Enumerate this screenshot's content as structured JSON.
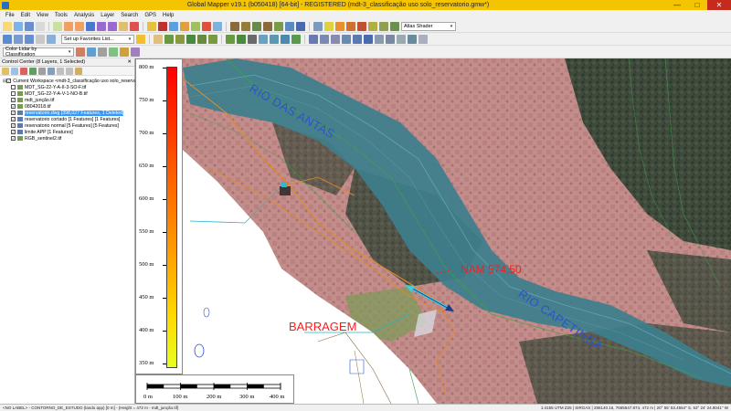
{
  "window": {
    "title": "Global Mapper v19.1 (b050418) [64-bit] - REGISTERED (mdt-3_classificação uso solo_reservatorio.gmw*)",
    "minimize": "—",
    "maximize": "□",
    "close": "✕"
  },
  "menu": [
    "File",
    "Edit",
    "View",
    "Tools",
    "Analysis",
    "Layer",
    "Search",
    "GPS",
    "Help"
  ],
  "toolbar": {
    "shader_select": "Atlas Shader",
    "favorites_select": "Set up Favorites List...",
    "color_lidar_select": "Color Lidar by Classification"
  },
  "control_center": {
    "title": "Control Center (8 Layers, 1 Selected)",
    "close": "✕",
    "workspace": "Current Workspace <mdt-3_classificação uso solo_reservatorio.gmw>",
    "layers": [
      {
        "label": "MDT_SG-22-Y-A-II-3-SO-F.tif",
        "checked": false
      },
      {
        "label": "MDT_SG-22-Y-A-V-1-NO-B.tif",
        "checked": false
      },
      {
        "label": "mdt_junção.tif",
        "checked": true
      },
      {
        "label": "08042018.tif",
        "checked": true
      },
      {
        "label": "reservatorio.dwg [398,027 Features, 1 Deleted]",
        "checked": true,
        "selected": true
      },
      {
        "label": "reservatorio cortado [1 Features] [1 Features]",
        "checked": true
      },
      {
        "label": "reservatorio normal [5 Features] [5 Features]",
        "checked": true
      },
      {
        "label": "limite APP [1 Features]",
        "checked": true
      },
      {
        "label": "RGB_sentinel2.tif",
        "checked": true
      }
    ]
  },
  "legend": {
    "labels": [
      "800 m",
      "750 m",
      "700 m",
      "650 m",
      "600 m",
      "550 m",
      "500 m",
      "450 m",
      "400 m",
      "350 m"
    ]
  },
  "scalebar": {
    "labels": [
      "0 m",
      "100 m",
      "200 m",
      "300 m",
      "400 m"
    ]
  },
  "map_labels": {
    "river_top": "RIO DAS ANTAS",
    "river_right": "RIO CAPETINGA",
    "nam": "NAM 574,50",
    "dam": "BARRAGEM"
  },
  "colors": {
    "title_bar": "#f4c400",
    "river": "#3d7f8d",
    "terrain_pink": "#c98f8c",
    "forest": "#3e4a3c",
    "label_red": "#ff1a1a",
    "label_blue": "#2a56c8"
  },
  "status": {
    "left": "<NO LABEL> - CONTORNO_DE_ESTUDO (lando app) [0 m] - (Height = 472 m - mdt_junção.tif)",
    "right": "1:4155  UTM Z25 | SIRGAS | 286140.16, 7665547.874, 472 m | 20° 55' 53.4554\" S, 53° 24' 24.8041\" W"
  },
  "icons": [
    "new-icon",
    "open-icon",
    "save-icon",
    "zoom-in-icon",
    "zoom-out-icon",
    "pan-icon",
    "measure-icon",
    "digitizer-icon",
    "3d-view-icon",
    "shader-icon",
    "settings-icon",
    "favorites-icon"
  ]
}
